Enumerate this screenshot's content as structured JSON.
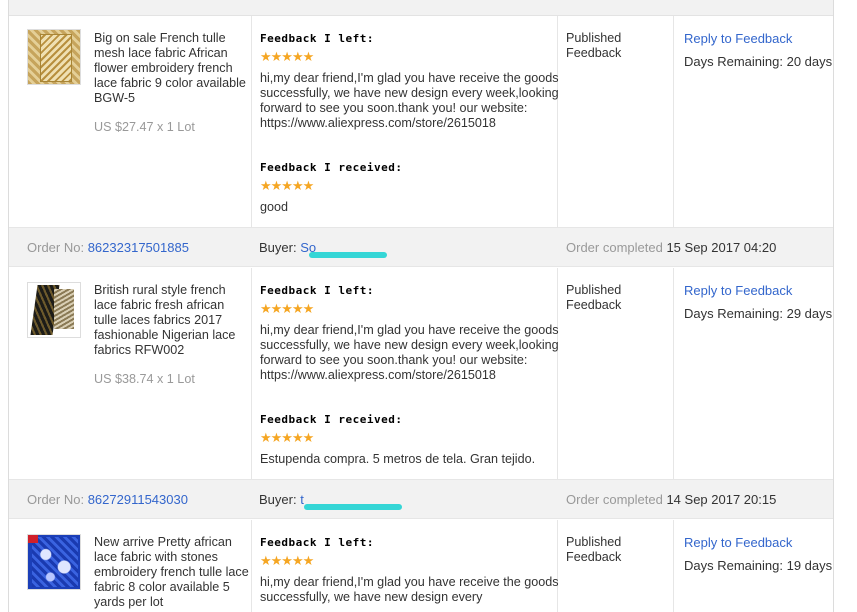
{
  "orders": [
    {
      "header": null,
      "product": {
        "title": "Big on sale French tulle mesh lace fabric African flower embroidery french lace fabric 9 color available BGW-5",
        "price": "US $27.47 x 1 Lot",
        "thumb_icon": "gold-lace-fabric-thumbnail"
      },
      "feedback_left_label": "Feedback I left:",
      "feedback_left_stars": "★★★★★",
      "feedback_left_text": "hi,my dear friend,I'm glad you have receive the goods successfully, we have new design every week,looking forward to see you soon.thank you! our website: https://www.aliexpress.com/store/2615018",
      "feedback_received_label": "Feedback I received:",
      "feedback_received_stars": "★★★★★",
      "feedback_received_text": "good",
      "status": "Published Feedback",
      "reply_label": "Reply to Feedback",
      "days_remaining": "Days Remaining: 20 days"
    },
    {
      "header": {
        "order_label": "Order No:",
        "order_no": "86232317501885",
        "buyer_label": "Buyer:",
        "buyer_name": "S",
        "buyer_name_tail": "o",
        "status_label": "Order completed",
        "date": "15 Sep 2017 04:20"
      },
      "product": {
        "title": "British rural style french lace fabric fresh african tulle laces fabrics 2017 fashionable Nigerian lace fabrics RFW002",
        "price": "US $38.74 x 1 Lot",
        "thumb_icon": "dark-lace-fabric-thumbnail"
      },
      "feedback_left_label": "Feedback I left:",
      "feedback_left_stars": "★★★★★",
      "feedback_left_text": "hi,my dear friend,I'm glad you have receive the goods successfully, we have new design every week,looking forward to see you soon.thank you! our website: https://www.aliexpress.com/store/2615018",
      "feedback_received_label": "Feedback I received:",
      "feedback_received_stars": "★★★★★",
      "feedback_received_text": "Estupenda compra. 5 metros de tela. Gran tejido.",
      "status": "Published Feedback",
      "reply_label": "Reply to Feedback",
      "days_remaining": "Days Remaining: 29 days"
    },
    {
      "header": {
        "order_label": "Order No:",
        "order_no": "86272911543030",
        "buyer_label": "Buyer:",
        "buyer_name": "t",
        "buyer_name_tail": "",
        "status_label": "Order completed",
        "date": "14 Sep 2017 20:15"
      },
      "product": {
        "title": "New arrive Pretty african lace fabric with stones embroidery french tulle lace fabric 8 color available 5 yards per lot",
        "price": "",
        "thumb_icon": "blue-lace-fabric-thumbnail"
      },
      "feedback_left_label": "Feedback I left:",
      "feedback_left_stars": "★★★★★",
      "feedback_left_text": "hi,my dear friend,I'm glad you have receive the goods successfully, we have new design every",
      "status": "Published Feedback",
      "reply_label": "Reply to Feedback",
      "days_remaining": "Days Remaining: 19 days"
    }
  ]
}
